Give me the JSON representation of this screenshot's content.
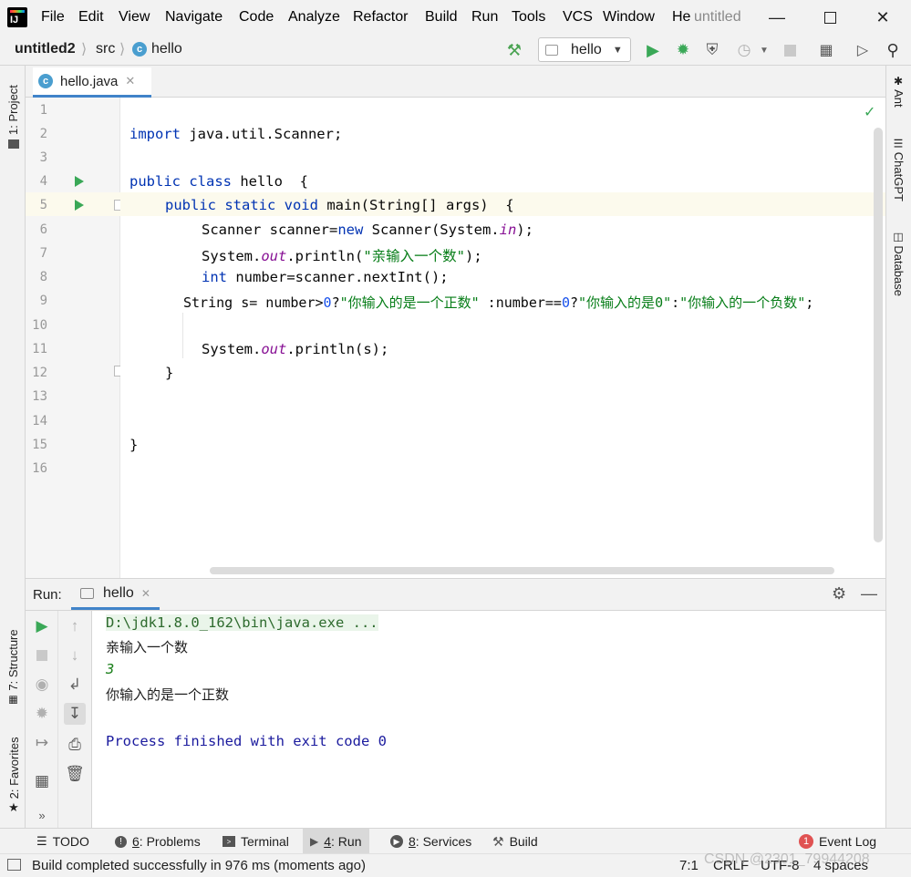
{
  "menubar": {
    "items": [
      "File",
      "Edit",
      "View",
      "Navigate",
      "Code",
      "Analyze",
      "Refactor",
      "Build",
      "Run",
      "Tools",
      "VCS",
      "Window",
      "He"
    ],
    "window_title": "untitled"
  },
  "navbar": {
    "breadcrumbs": [
      "untitled2",
      "src",
      "hello"
    ],
    "run_config": "hello"
  },
  "left_stripe": {
    "project": "1: Project",
    "structure": "7: Structure",
    "favorites": "2: Favorites"
  },
  "right_stripe": {
    "ant": "Ant",
    "chatgpt": "ChatGPT",
    "database": "Database"
  },
  "editor": {
    "tab_label": "hello.java",
    "line_numbers": [
      "1",
      "2",
      "3",
      "4",
      "5",
      "6",
      "7",
      "8",
      "9",
      "10",
      "11",
      "12",
      "13",
      "14",
      "15",
      "16"
    ],
    "code": {
      "l2_kw": "import",
      "l2_rest": " java.util.Scanner;",
      "l4_kw": "public class",
      "l4_rest": " hello  {",
      "l5_kw": "public static void",
      "l5_rest": " main(String[] args)  {",
      "l6_a": "Scanner scanner=",
      "l6_kw": "new",
      "l6_b": " Scanner(System.",
      "l6_fld": "in",
      "l6_c": ");",
      "l7_a": "System.",
      "l7_fld": "out",
      "l7_b": ".println(",
      "l7_str": "\"亲输入一个数\"",
      "l7_c": ");",
      "l8_kw": "int",
      "l8_rest": " number=scanner.nextInt();",
      "l9_a": "String s= number>",
      "l9_n1": "0",
      "l9_b": "?",
      "l9_s1": "\"你输入的是一个正数\"",
      "l9_c": " :number==",
      "l9_n2": "0",
      "l9_d": "?",
      "l9_s2": "\"你输入的是0\"",
      "l9_e": ":",
      "l9_s3": "\"你输入的一个负数\"",
      "l9_f": ";",
      "l11_a": "System.",
      "l11_fld": "out",
      "l11_b": ".println(s);",
      "l12": "}",
      "l15": "}"
    }
  },
  "run_panel": {
    "label": "Run:",
    "tab_label": "hello",
    "console": {
      "command": "D:\\jdk1.8.0_162\\bin\\java.exe ...",
      "prompt": "亲输入一个数",
      "input": "3",
      "output": "你输入的是一个正数",
      "exit": "Process finished with exit code 0"
    }
  },
  "tool_bar": {
    "todo": "TODO",
    "problems_num": "6",
    "problems": ": Problems",
    "terminal": "Terminal",
    "run_num": "4",
    "run": ": Run",
    "services_num": "8",
    "services": ": Services",
    "build": "Build",
    "event_log_count": "1",
    "event_log": "Event Log"
  },
  "status_bar": {
    "message": "Build completed successfully in 976 ms (moments ago)",
    "position": "7:1",
    "line_sep": "CRLF",
    "encoding": "UTF-8",
    "indent": "4 spaces",
    "watermark": "CSDN @2301_79944208"
  },
  "colors": {
    "keyword": "#0033b3",
    "string": "#067d17",
    "number": "#1750eb",
    "field": "#871094",
    "run_green": "#3aa857",
    "console_blue": "#1b1b9e",
    "console_input": "#1a7f1a"
  }
}
